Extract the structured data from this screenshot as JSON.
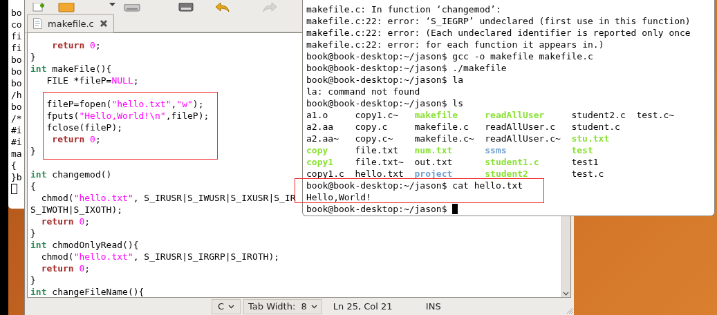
{
  "background_terminal": {
    "lines": [
      "bo",
      "co",
      "fi",
      "fi",
      "bo",
      "bo",
      "bo",
      "/h",
      "bo",
      "/*",
      "#i",
      "#i",
      "ma",
      "{",
      "}b"
    ]
  },
  "editor_window": {
    "tabs": [
      {
        "label": "makefile.c"
      }
    ],
    "lines": [
      {
        "kind": "code",
        "tokens": [
          {
            "kind": "keyword",
            "text": "    return "
          },
          {
            "kind": "number",
            "text": "0"
          },
          {
            "kind": "plain",
            "text": ";"
          }
        ]
      },
      {
        "kind": "code",
        "tokens": [
          {
            "kind": "plain",
            "text": "}"
          }
        ]
      },
      {
        "kind": "code",
        "tokens": [
          {
            "kind": "type",
            "text": "int"
          },
          {
            "kind": "plain",
            "text": " makeFile(){"
          }
        ]
      },
      {
        "kind": "code",
        "tokens": [
          {
            "kind": "plain",
            "text": "   FILE *fileP="
          },
          {
            "kind": "constant",
            "text": "NULL"
          },
          {
            "kind": "plain",
            "text": ";"
          }
        ]
      },
      {
        "kind": "blank"
      },
      {
        "kind": "code",
        "tokens": [
          {
            "kind": "plain",
            "text": "   fileP=fopen("
          },
          {
            "kind": "string",
            "text": "\"hello.txt\""
          },
          {
            "kind": "plain",
            "text": ","
          },
          {
            "kind": "string",
            "text": "\"w\""
          },
          {
            "kind": "plain",
            "text": ");"
          }
        ]
      },
      {
        "kind": "code",
        "tokens": [
          {
            "kind": "plain",
            "text": "   fputs("
          },
          {
            "kind": "string",
            "text": "\"Hello,World!\\n\""
          },
          {
            "kind": "plain",
            "text": ",fileP);"
          }
        ]
      },
      {
        "kind": "code",
        "tokens": [
          {
            "kind": "plain",
            "text": "   fclose(fileP);"
          }
        ]
      },
      {
        "kind": "code",
        "tokens": [
          {
            "kind": "keyword",
            "text": "    return "
          },
          {
            "kind": "number",
            "text": "0"
          },
          {
            "kind": "plain",
            "text": ";"
          }
        ]
      },
      {
        "kind": "code",
        "tokens": [
          {
            "kind": "plain",
            "text": "}"
          }
        ]
      },
      {
        "kind": "blank"
      },
      {
        "kind": "code",
        "tokens": [
          {
            "kind": "type",
            "text": "int"
          },
          {
            "kind": "plain",
            "text": " changemod()"
          }
        ]
      },
      {
        "kind": "code",
        "tokens": [
          {
            "kind": "plain",
            "text": "{"
          }
        ]
      },
      {
        "kind": "code",
        "tokens": [
          {
            "kind": "plain",
            "text": "  chmod("
          },
          {
            "kind": "string",
            "text": "\"hello.txt\""
          },
          {
            "kind": "plain",
            "text": ", S_IRUSR|S_IWUSR|S_IXUSR|S_IR"
          }
        ]
      },
      {
        "kind": "code",
        "tokens": [
          {
            "kind": "plain",
            "text": "S_IWOTH|S_IXOTH);"
          }
        ]
      },
      {
        "kind": "code",
        "tokens": [
          {
            "kind": "keyword",
            "text": "  return "
          },
          {
            "kind": "number",
            "text": "0"
          },
          {
            "kind": "plain",
            "text": ";"
          }
        ]
      },
      {
        "kind": "code",
        "tokens": [
          {
            "kind": "plain",
            "text": "}"
          }
        ]
      },
      {
        "kind": "code",
        "tokens": [
          {
            "kind": "type",
            "text": "int"
          },
          {
            "kind": "plain",
            "text": " chmodOnlyRead(){"
          }
        ]
      },
      {
        "kind": "code",
        "tokens": [
          {
            "kind": "plain",
            "text": "  chmod("
          },
          {
            "kind": "string",
            "text": "\"hello.txt\""
          },
          {
            "kind": "plain",
            "text": ", S_IRUSR|S_IRGRP|S_IROTH);"
          }
        ]
      },
      {
        "kind": "code",
        "tokens": [
          {
            "kind": "keyword",
            "text": "  return "
          },
          {
            "kind": "number",
            "text": "0"
          },
          {
            "kind": "plain",
            "text": ";"
          }
        ]
      },
      {
        "kind": "code",
        "tokens": [
          {
            "kind": "plain",
            "text": "}"
          }
        ]
      },
      {
        "kind": "code",
        "tokens": [
          {
            "kind": "type",
            "text": "int"
          },
          {
            "kind": "plain",
            "text": " changeFileName(){"
          }
        ]
      }
    ],
    "status_bar": {
      "language": "C",
      "tab_width": "Tab Width:  8",
      "position": "Ln 25, Col 21",
      "mode": "INS"
    }
  },
  "terminal": {
    "lines_before": [
      "makefile.c: In function ‘changemod’:",
      "makefile.c:22: error: ‘S_IEGRP’ undeclared (first use in this function)",
      "makefile.c:22: error: (Each undeclared identifier is reported only once",
      "makefile.c:22: error: for each function it appears in.)",
      "book@book-desktop:~/jason$ gcc -o makefile makefile.c",
      "book@book-desktop:~/jason$ ./makefile",
      "book@book-desktop:~/jason$ la",
      "la: command not found",
      "book@book-desktop:~/jason$ ls"
    ],
    "ls_listing": [
      [
        {
          "name": "a1.o",
          "kind": "file"
        },
        {
          "name": "copy1.c~",
          "kind": "file"
        },
        {
          "name": "makefile",
          "kind": "exec"
        },
        {
          "name": "readAllUser",
          "kind": "exec"
        },
        {
          "name": "student2.c",
          "kind": "file"
        },
        {
          "name": "test.c~",
          "kind": "file"
        }
      ],
      [
        {
          "name": "a2.aa",
          "kind": "file"
        },
        {
          "name": "copy.c",
          "kind": "file"
        },
        {
          "name": "makefile.c",
          "kind": "file"
        },
        {
          "name": "readAllUser.c",
          "kind": "file"
        },
        {
          "name": "student.c",
          "kind": "file"
        }
      ],
      [
        {
          "name": "a2.aa~",
          "kind": "file"
        },
        {
          "name": "copy.c~",
          "kind": "file"
        },
        {
          "name": "makefile.c~",
          "kind": "file"
        },
        {
          "name": "readAllUser.c~",
          "kind": "file"
        },
        {
          "name": "stu.txt",
          "kind": "exec"
        }
      ],
      [
        {
          "name": "copy",
          "kind": "exec"
        },
        {
          "name": "file.txt",
          "kind": "file"
        },
        {
          "name": "num.txt",
          "kind": "exec"
        },
        {
          "name": "ssms",
          "kind": "dir"
        },
        {
          "name": "test",
          "kind": "exec"
        }
      ],
      [
        {
          "name": "copy1",
          "kind": "exec"
        },
        {
          "name": "file.txt~",
          "kind": "file"
        },
        {
          "name": "out.txt",
          "kind": "file"
        },
        {
          "name": "student1.c",
          "kind": "exec"
        },
        {
          "name": "test1",
          "kind": "file"
        }
      ],
      [
        {
          "name": "copy1.c",
          "kind": "file"
        },
        {
          "name": "hello.txt",
          "kind": "file"
        },
        {
          "name": "project",
          "kind": "dir"
        },
        {
          "name": "student2",
          "kind": "exec"
        },
        {
          "name": "test.c",
          "kind": "file"
        }
      ]
    ],
    "lines_after": [
      "book@book-desktop:~/jason$ cat hello.txt",
      "Hello,World!"
    ],
    "prompt": "book@book-desktop:~/jason$ "
  }
}
